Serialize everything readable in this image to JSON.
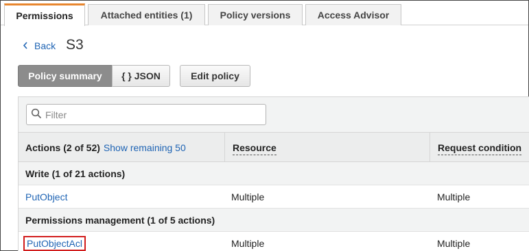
{
  "tabs": [
    {
      "label": "Permissions",
      "active": true
    },
    {
      "label": "Attached entities (1)",
      "active": false
    },
    {
      "label": "Policy versions",
      "active": false
    },
    {
      "label": "Access Advisor",
      "active": false
    }
  ],
  "header": {
    "back_label": "Back",
    "title": "S3"
  },
  "view_buttons": {
    "summary_label": "Policy summary",
    "json_label": "{ } JSON",
    "edit_label": "Edit policy"
  },
  "filter": {
    "placeholder": "Filter"
  },
  "table": {
    "headers": {
      "actions": "Actions (2 of 52)",
      "show_remaining": "Show remaining 50",
      "resource": "Resource",
      "request_condition": "Request condition"
    },
    "groups": [
      {
        "title": "Write (1 of 21 actions)",
        "rows": [
          {
            "action": "PutObject",
            "resource": "Multiple",
            "condition": "Multiple"
          }
        ]
      },
      {
        "title": "Permissions management (1 of 5 actions)",
        "rows": [
          {
            "action": "PutObjectAcl",
            "resource": "Multiple",
            "condition": "Multiple"
          }
        ]
      }
    ]
  },
  "colors": {
    "accent_tab": "#e8862e",
    "link": "#1f64b4",
    "highlight_box": "#d11b1b"
  }
}
